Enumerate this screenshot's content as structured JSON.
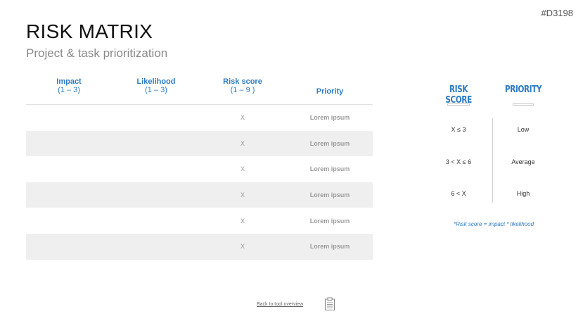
{
  "slide_id": "#D3198",
  "title": "RISK MATRIX",
  "subtitle": "Project & task prioritization",
  "table": {
    "headers": [
      {
        "name": "Impact",
        "sub": "(1 – 3)"
      },
      {
        "name": "Likelihood",
        "sub": "(1 – 3)"
      },
      {
        "name": "Risk score",
        "sub": "(1 – 9 )"
      },
      {
        "name": "Priority",
        "sub": ""
      }
    ],
    "rows": [
      {
        "score": "X",
        "priority": "Lorem ipsum"
      },
      {
        "score": "X",
        "priority": "Lorem ipsum"
      },
      {
        "score": "X",
        "priority": "Lorem ipsum"
      },
      {
        "score": "X",
        "priority": "Lorem ipsum"
      },
      {
        "score": "X",
        "priority": "Lorem ipsum"
      },
      {
        "score": "X",
        "priority": "Lorem ipsum"
      }
    ]
  },
  "legend": {
    "score_header": "RISK SCORE",
    "priority_header": "PRIORITY",
    "rows": [
      {
        "score": "X ≤ 3",
        "priority": "Low"
      },
      {
        "score": "3 < X ≤ 6",
        "priority": "Average"
      },
      {
        "score": "6 < X",
        "priority": "High"
      }
    ],
    "note": "*Risk score = impact * likelihood"
  },
  "footer": {
    "back_link": "Back to tool overview",
    "icon": "clipboard-icon"
  },
  "colors": {
    "accent": "#2d7cc4",
    "row_alt": "#efefef"
  }
}
